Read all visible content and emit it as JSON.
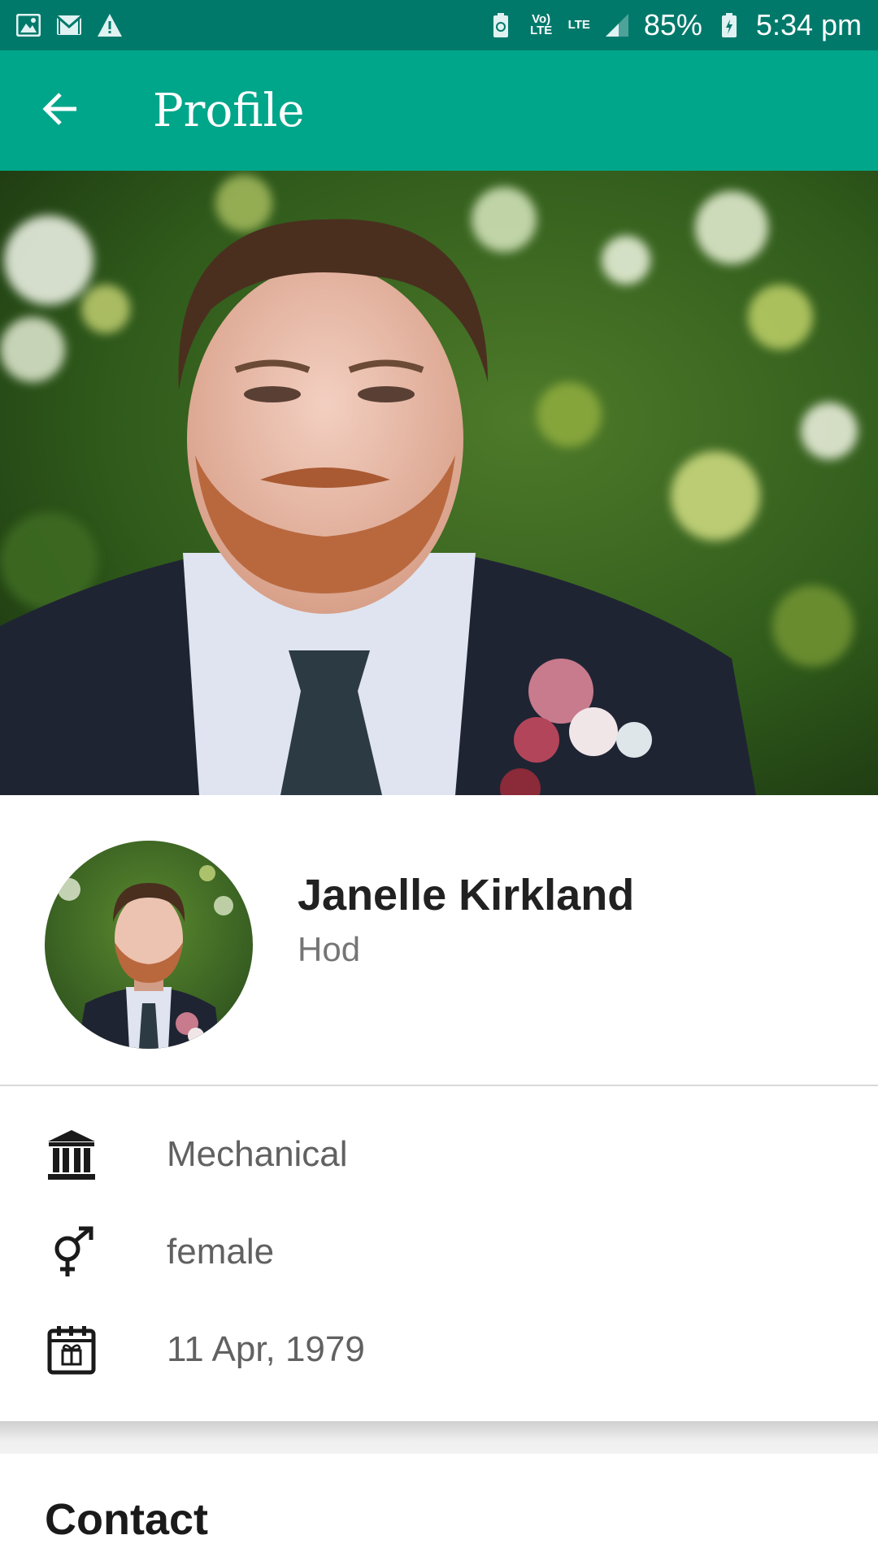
{
  "status_bar": {
    "left_icons": [
      "image-icon",
      "gmail-icon",
      "warning-icon"
    ],
    "volte_label": "Vo) LTE",
    "lte_label": "LTE",
    "battery_percent": "85%",
    "time": "5:34 pm"
  },
  "app_bar": {
    "title": "Profile",
    "back_icon": "arrow-left-icon"
  },
  "profile": {
    "name": "Janelle Kirkland",
    "role": "Hod"
  },
  "details": [
    {
      "icon": "institution-icon",
      "value": "Mechanical"
    },
    {
      "icon": "gender-icon",
      "value": "female"
    },
    {
      "icon": "birthday-calendar-icon",
      "value": "11 Apr, 1979"
    }
  ],
  "contact": {
    "title": "Contact"
  },
  "colors": {
    "status_bar": "#00796b",
    "app_bar": "#00a68a",
    "text_primary": "#212121",
    "text_secondary": "#757575"
  }
}
